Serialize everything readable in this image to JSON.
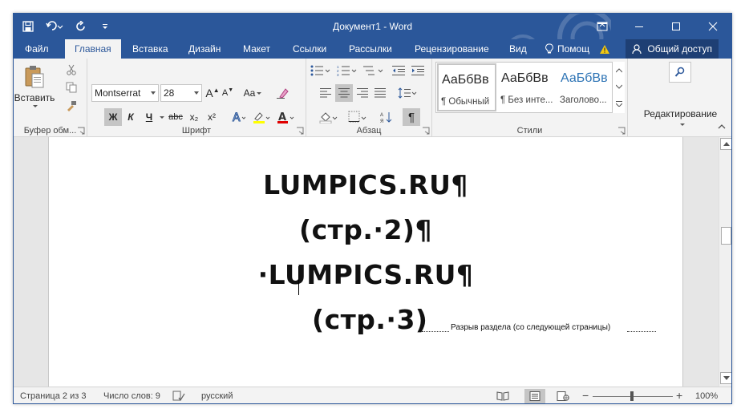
{
  "app": {
    "window_title": "Документ1 - Word",
    "brand_color": "#2b579a"
  },
  "qat": {
    "save_icon": "save-icon",
    "undo_icon": "undo-icon",
    "redo_icon": "repeat-icon",
    "customize_icon": "customize-qat-icon"
  },
  "tabs": [
    {
      "label": "Файл"
    },
    {
      "label": "Главная"
    },
    {
      "label": "Вставка"
    },
    {
      "label": "Дизайн"
    },
    {
      "label": "Макет"
    },
    {
      "label": "Ссылки"
    },
    {
      "label": "Рассылки"
    },
    {
      "label": "Рецензирование"
    },
    {
      "label": "Вид"
    }
  ],
  "active_tab": "Главная",
  "tell_me": {
    "label": "Помощ"
  },
  "share": {
    "label": "Общий доступ"
  },
  "ribbon": {
    "clipboard": {
      "paste_label": "Вставить",
      "group_label": "Буфер обм..."
    },
    "font": {
      "font_name": "Montserrat",
      "font_size": "28",
      "bold": "Ж",
      "italic": "К",
      "underline": "Ч",
      "strike": "abc",
      "subscript": "x₂",
      "superscript": "x²",
      "case": "Aa",
      "group_label": "Шрифт"
    },
    "paragraph": {
      "group_label": "Абзац",
      "pilcrow": "¶"
    },
    "styles": {
      "items": [
        {
          "sample": "АаБбВв",
          "name": "¶ Обычный"
        },
        {
          "sample": "АаБбВв",
          "name": "¶ Без инте..."
        },
        {
          "sample": "АаБбВв",
          "name": "Заголово..."
        }
      ],
      "heading_color": "#2e74b5",
      "group_label": "Стили"
    },
    "editing": {
      "label": "Редактирование"
    }
  },
  "document": {
    "lines": [
      "LUMPICS.RU¶",
      "(стр.·2)¶",
      "·LUMPICS.RU¶",
      "(стр.·3)"
    ],
    "section_break": "Разрыв раздела (со следующей страницы)"
  },
  "status": {
    "page": "Страница 2 из 3",
    "words": "Число слов: 9",
    "language": "русский",
    "zoom": "100%"
  }
}
